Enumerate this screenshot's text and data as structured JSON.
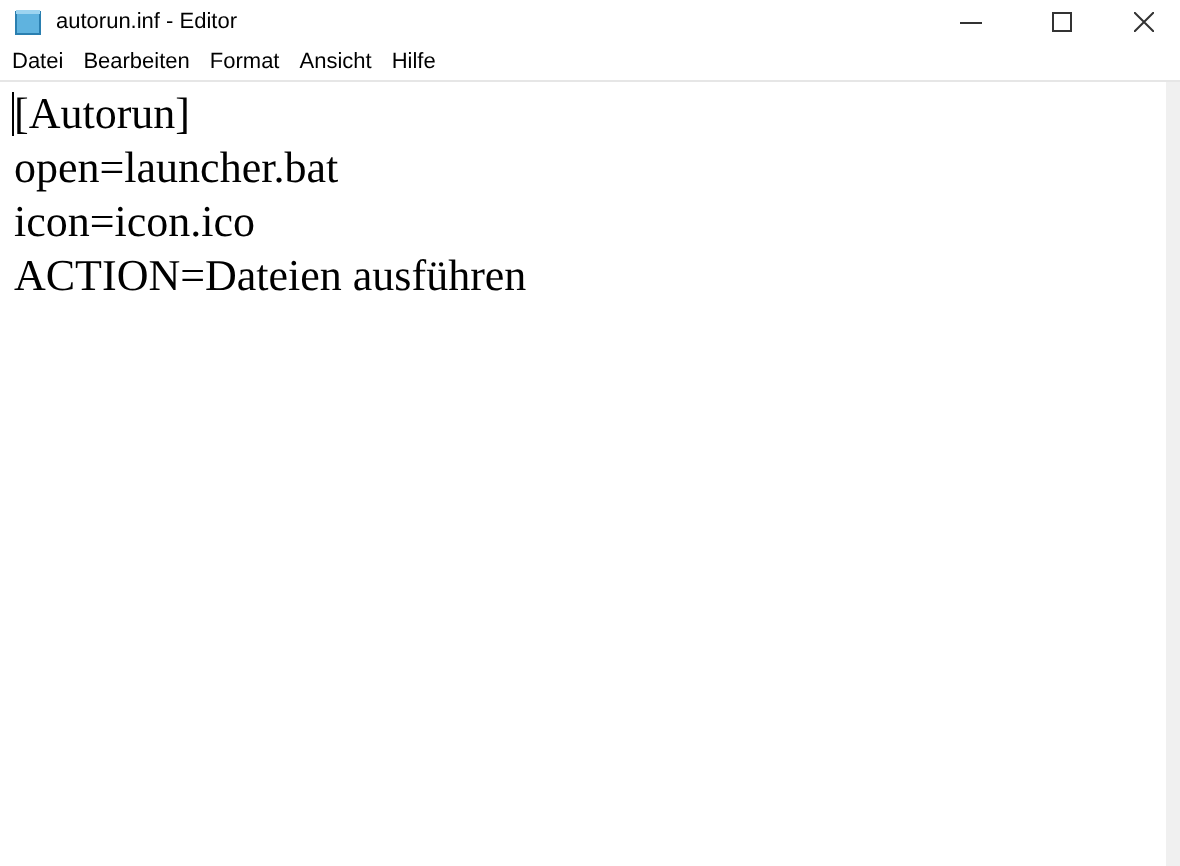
{
  "window": {
    "title": "autorun.inf - Editor"
  },
  "menu": [
    "Datei",
    "Bearbeiten",
    "Format",
    "Ansicht",
    "Hilfe"
  ],
  "editor": {
    "lines": [
      "[Autorun]",
      "open=launcher.bat",
      "icon=icon.ico",
      "ACTION=Dateien ausführen"
    ]
  }
}
